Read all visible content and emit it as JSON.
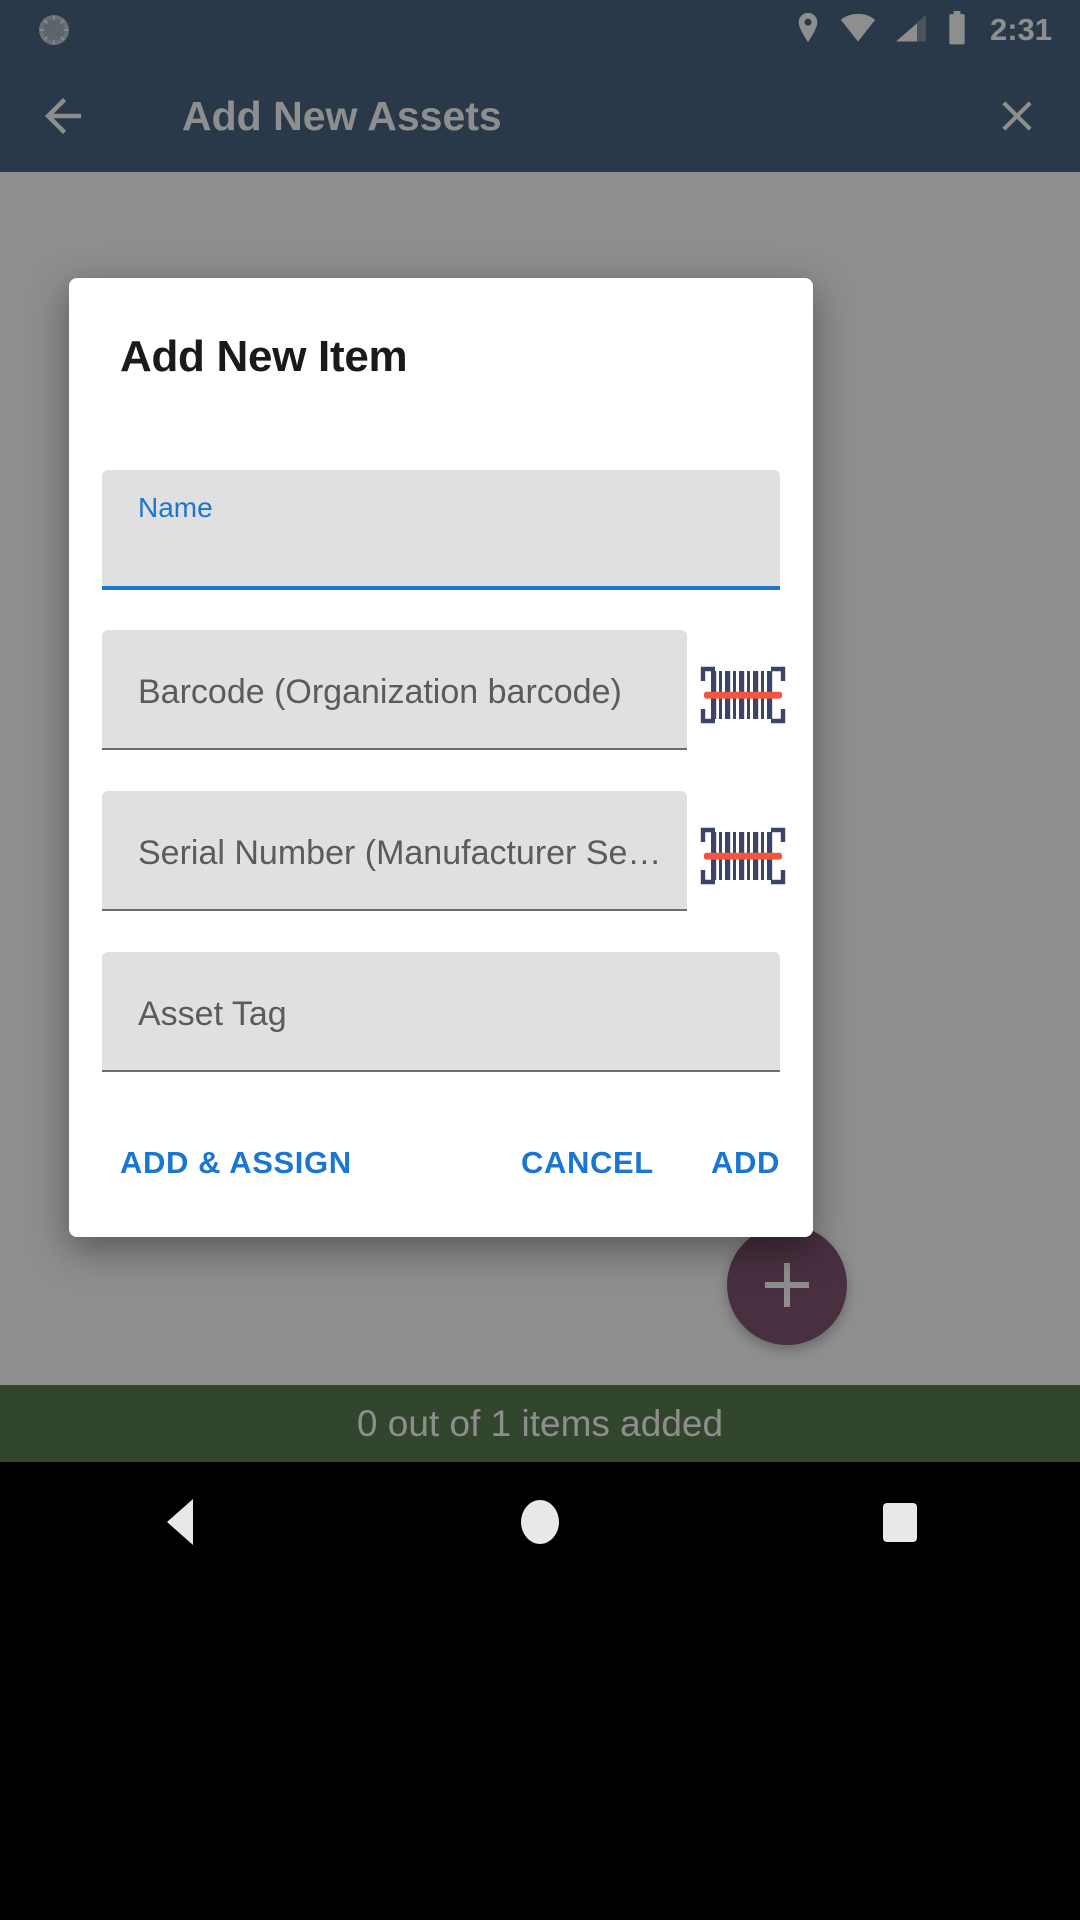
{
  "status_bar": {
    "time": "2:31",
    "icons": [
      "sync-spinner-icon",
      "location-pin-icon",
      "wifi-icon",
      "cellular-signal-icon",
      "battery-icon"
    ]
  },
  "app_bar": {
    "title": "Add New Assets",
    "back_icon": "back-arrow-icon",
    "close_icon": "close-x-icon",
    "background_color": "#12365c"
  },
  "fab": {
    "icon": "plus-icon",
    "color": "#5b1f47"
  },
  "snackbar": {
    "message": "0 out of 1 items added",
    "background_color": "#24511a"
  },
  "dialog": {
    "title": "Add New Item",
    "fields": [
      {
        "label": "Name",
        "value": "",
        "focused": true,
        "has_scanner": false
      },
      {
        "label": "Barcode (Organization barcode)",
        "value": "",
        "focused": false,
        "has_scanner": true,
        "scanner_icon": "barcode-scan-icon"
      },
      {
        "label": "Serial Number (Manufacturer Se…",
        "value": "",
        "focused": false,
        "has_scanner": true,
        "scanner_icon": "barcode-scan-icon"
      },
      {
        "label": "Asset Tag",
        "value": "",
        "focused": false,
        "has_scanner": false
      }
    ],
    "actions": {
      "add_and_assign": "ADD & ASSIGN",
      "cancel": "CANCEL",
      "add": "ADD"
    },
    "accent_color": "#1b76d2"
  },
  "nav_bar": {
    "back": "nav-back-icon",
    "home": "nav-home-icon",
    "recents": "nav-recents-icon"
  }
}
